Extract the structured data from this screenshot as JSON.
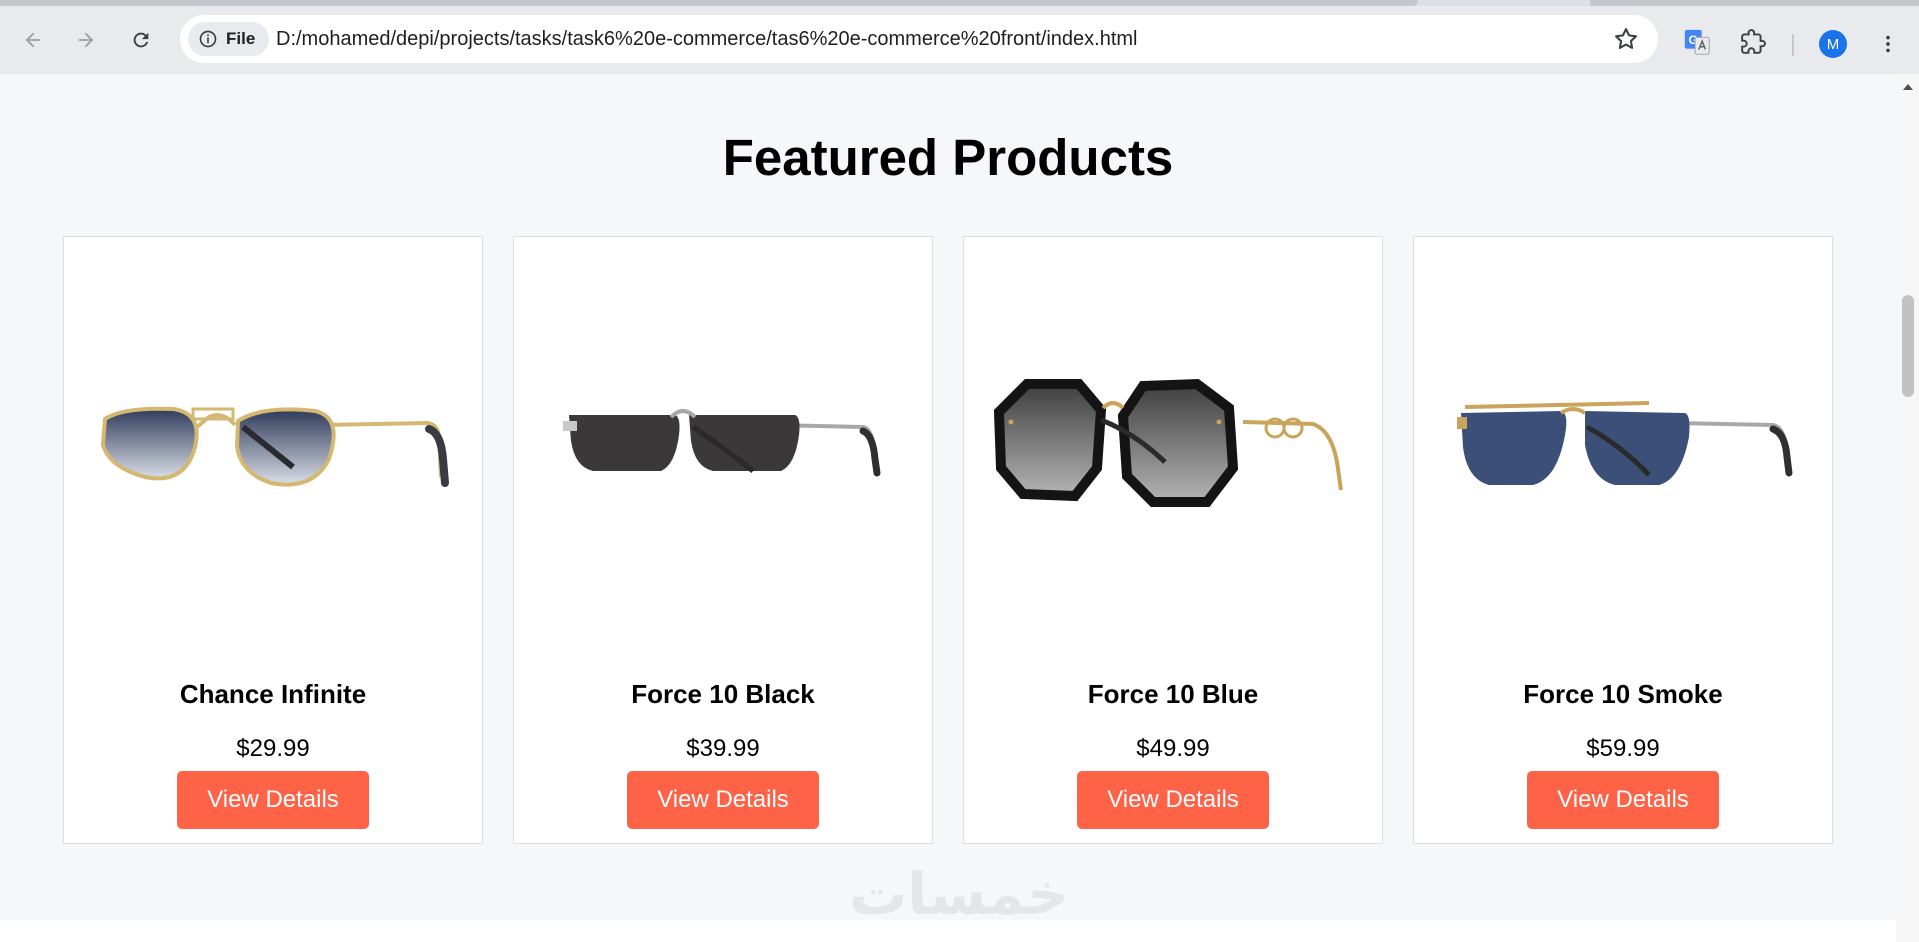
{
  "browser": {
    "site_chip_label": "File",
    "url": "D:/mohamed/depi/projects/tasks/task6%20e-commerce/tas6%20e-commerce%20front/index.html",
    "profile_initial": "M"
  },
  "page": {
    "section_title": "Featured Products",
    "watermark": "خمسات",
    "products": [
      {
        "name": "Chance Infinite",
        "price": "$29.99",
        "button_label": "View Details",
        "lens_color": "#2f3b5a",
        "frame_color": "#d4b872"
      },
      {
        "name": "Force 10 Black",
        "price": "$39.99",
        "button_label": "View Details",
        "lens_color": "#3a3839",
        "frame_color": "#a8a8a8"
      },
      {
        "name": "Force 10 Blue",
        "price": "$49.99",
        "button_label": "View Details",
        "lens_color": "#4a4a4a",
        "frame_color": "#141414"
      },
      {
        "name": "Force 10 Smoke",
        "price": "$59.99",
        "button_label": "View Details",
        "lens_color": "#3c4f78",
        "frame_color": "#c9a45a"
      }
    ]
  },
  "colors": {
    "accent": "#ff6347",
    "page_bg": "#f6f7f8",
    "card_border": "#dedede"
  }
}
